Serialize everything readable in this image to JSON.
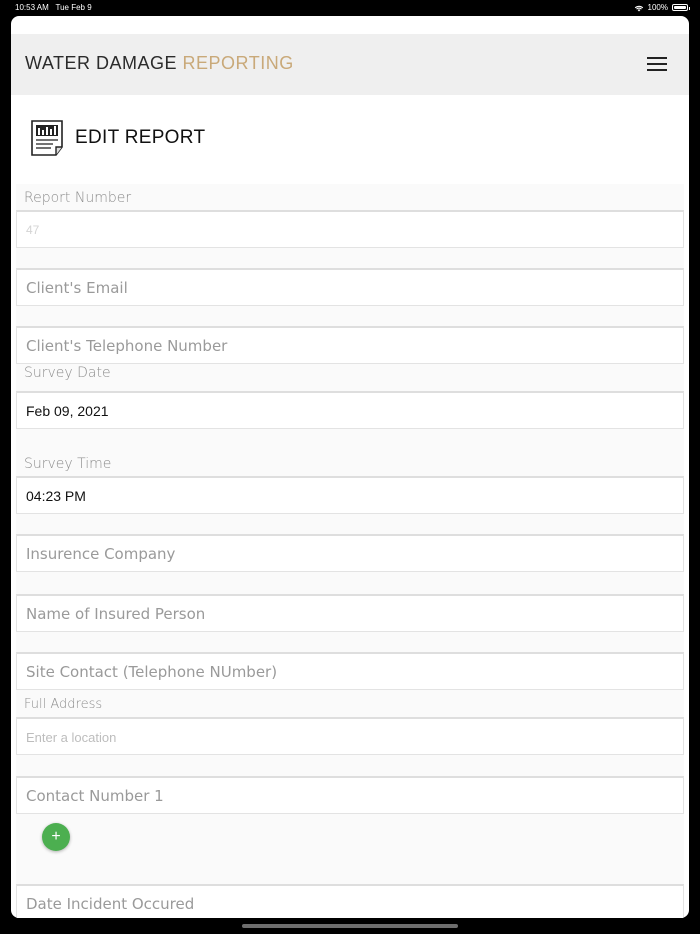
{
  "status_bar": {
    "time": "10:53 AM",
    "date": "Tue Feb 9",
    "battery": "100%"
  },
  "header": {
    "brand_main": "WATER DAMAGE",
    "brand_accent": "REPORTING",
    "accent_color": "#c9a979"
  },
  "page": {
    "title": "EDIT REPORT"
  },
  "form": {
    "report_number_label": "Report Number",
    "report_number_value": "47",
    "client_email_placeholder": "Client's Email",
    "client_phone_placeholder": "Client's Telephone Number",
    "survey_date_label": "Survey Date",
    "survey_date_value": "Feb 09, 2021",
    "survey_time_label": "Survey Time",
    "survey_time_value": "04:23 PM",
    "insurance_company_placeholder": "Insurence Company",
    "insured_person_placeholder": "Name of Insured Person",
    "site_contact_placeholder": "Site Contact (Telephone NUmber)",
    "full_address_label": "Full Address",
    "full_address_placeholder": "Enter a location",
    "contact_number_placeholder": "Contact Number 1",
    "add_button_label": "+",
    "date_incident_placeholder": "Date Incident Occured"
  },
  "colors": {
    "add_button": "#4caf50",
    "header_bg": "#efefef"
  }
}
